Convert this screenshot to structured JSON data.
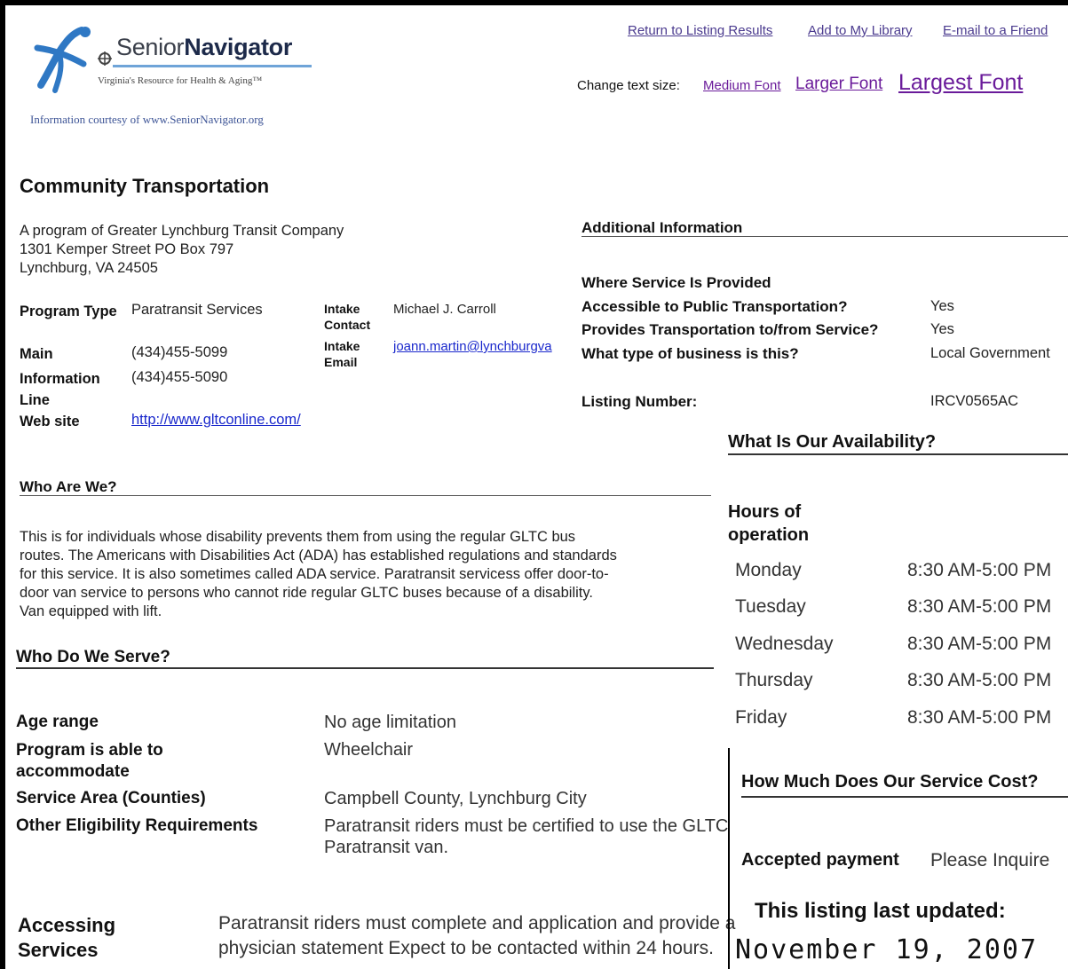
{
  "logo": {
    "name_prefix": "Senior",
    "name_bold": "Navigator",
    "tagline": "Virginia's Resource for Health & Aging™",
    "courtesy": "Information courtesy of www.SeniorNavigator.org"
  },
  "top_links": {
    "return_label": "Return to Listing Results",
    "library_label": "Add to My Library",
    "email_label": "E-mail to a Friend"
  },
  "text_size": {
    "label": "Change text size:",
    "medium": "Medium Font",
    "larger": "Larger Font",
    "largest": "Largest Font"
  },
  "listing": {
    "title": "Community Transportation",
    "address_line1": "A program of Greater Lynchburg Transit Company",
    "address_line2": "1301 Kemper Street  PO Box 797",
    "address_line3": "Lynchburg,  VA   24505",
    "program_type_label": "Program Type",
    "program_type_value": "Paratransit Services",
    "main_label": "Main",
    "main_value": "(434)455-5099",
    "info_line_label": "Information Line",
    "info_line_value": "(434)455-5090",
    "website_label": "Web site",
    "website_value": "http://www.gltconline.com/",
    "intake_contact_label": "Intake Contact",
    "intake_contact_value": "Michael J. Carroll",
    "intake_email_label": "Intake Email",
    "intake_email_value": "joann.martin@lynchburgva"
  },
  "additional": {
    "heading": "Additional Information",
    "where_label": "Where Service Is Provided",
    "accessible_label": "Accessible to Public Transportation?",
    "accessible_value": "Yes",
    "transport_label": "Provides Transportation to/from Service?",
    "transport_value": "Yes",
    "business_label": "What type of business is this?",
    "business_value": "Local Government",
    "listing_number_label": "Listing Number:",
    "listing_number_value": "IRCV0565AC"
  },
  "who_are_we": {
    "heading": "Who Are We?",
    "lines": [
      "This is for individuals whose disability prevents them from using the regular GLTC bus",
      "routes. The Americans with Disabilities Act (ADA) has established regulations and standards",
      "for this service. It is also sometimes called ADA service. Paratransit servicess offer door-to-",
      "door van service to persons who cannot ride regular GLTC buses because of a disability.",
      "Van equipped with lift."
    ]
  },
  "who_we_serve": {
    "heading": "Who Do We Serve?",
    "age_label": "Age range",
    "age_value": "No age limitation",
    "accommodate_label": "Program is able to accommodate",
    "accommodate_value": "Wheelchair",
    "area_label": "Service Area (Counties)",
    "area_value": "Campbell County, Lynchburg City",
    "other_label": "Other Eligibility Requirements",
    "other_value_line1": "Paratransit riders must be certified to use the GLTC",
    "other_value_line2": "Paratransit van."
  },
  "accessing": {
    "label": "Accessing Services",
    "value_line1": "Paratransit riders must complete and application and provide a",
    "value_line2": "physician statement Expect to be contacted within 24 hours."
  },
  "availability": {
    "heading": "What Is Our Availability?",
    "hours_label": "Hours of operation",
    "days": [
      {
        "day": "Monday",
        "time": "8:30 AM-5:00 PM"
      },
      {
        "day": "Tuesday",
        "time": "8:30 AM-5:00 PM"
      },
      {
        "day": "Wednesday",
        "time": "8:30 AM-5:00 PM"
      },
      {
        "day": "Thursday",
        "time": "8:30 AM-5:00 PM"
      },
      {
        "day": "Friday",
        "time": "8:30 AM-5:00 PM"
      }
    ]
  },
  "cost": {
    "heading": "How Much Does Our Service Cost?",
    "payment_label": "Accepted payment",
    "payment_value": "Please Inquire"
  },
  "updated": {
    "label": "This listing last updated:",
    "date": "November 19, 2007"
  }
}
